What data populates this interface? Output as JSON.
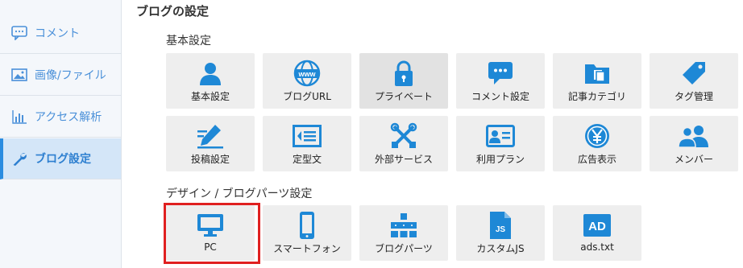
{
  "sidebar": {
    "items": [
      {
        "label": "コメント",
        "icon": "comment-icon"
      },
      {
        "label": "画像/ファイル",
        "icon": "image-icon"
      },
      {
        "label": "アクセス解析",
        "icon": "bar-chart-icon"
      },
      {
        "label": "ブログ設定",
        "icon": "wrench-icon",
        "active": true
      }
    ]
  },
  "main": {
    "title": "ブログの設定",
    "sections": {
      "basic": {
        "title": "基本設定",
        "tiles": [
          {
            "label": "基本設定",
            "icon": "user-icon"
          },
          {
            "label": "ブログURL",
            "icon": "www-globe-icon"
          },
          {
            "label": "プライベート",
            "icon": "lock-icon"
          },
          {
            "label": "コメント設定",
            "icon": "speech-bubble-icon"
          },
          {
            "label": "記事カテゴリ",
            "icon": "folder-icon"
          },
          {
            "label": "タグ管理",
            "icon": "tag-icon"
          },
          {
            "label": "投稿設定",
            "icon": "pencil-icon"
          },
          {
            "label": "定型文",
            "icon": "template-icon"
          },
          {
            "label": "外部サービス",
            "icon": "external-tools-icon"
          },
          {
            "label": "利用プラン",
            "icon": "id-card-icon"
          },
          {
            "label": "広告表示",
            "icon": "yen-icon"
          },
          {
            "label": "メンバー",
            "icon": "members-icon"
          }
        ]
      },
      "design": {
        "title": "デザイン / ブログパーツ設定",
        "tiles": [
          {
            "label": "PC",
            "icon": "monitor-icon",
            "selected": true
          },
          {
            "label": "スマートフォン",
            "icon": "smartphone-icon"
          },
          {
            "label": "ブログパーツ",
            "icon": "blog-parts-icon"
          },
          {
            "label": "カスタムJS",
            "icon": "js-file-icon"
          },
          {
            "label": "ads.txt",
            "icon": "ad-icon"
          }
        ]
      }
    }
  },
  "icon_text": {
    "www": "www",
    "js": "JS",
    "ad": "AD"
  },
  "colors": {
    "accent": "#1e88d6",
    "sidebar_text": "#4a90d9",
    "selected_border": "#e02020",
    "tile_bg": "#eeeeee"
  }
}
